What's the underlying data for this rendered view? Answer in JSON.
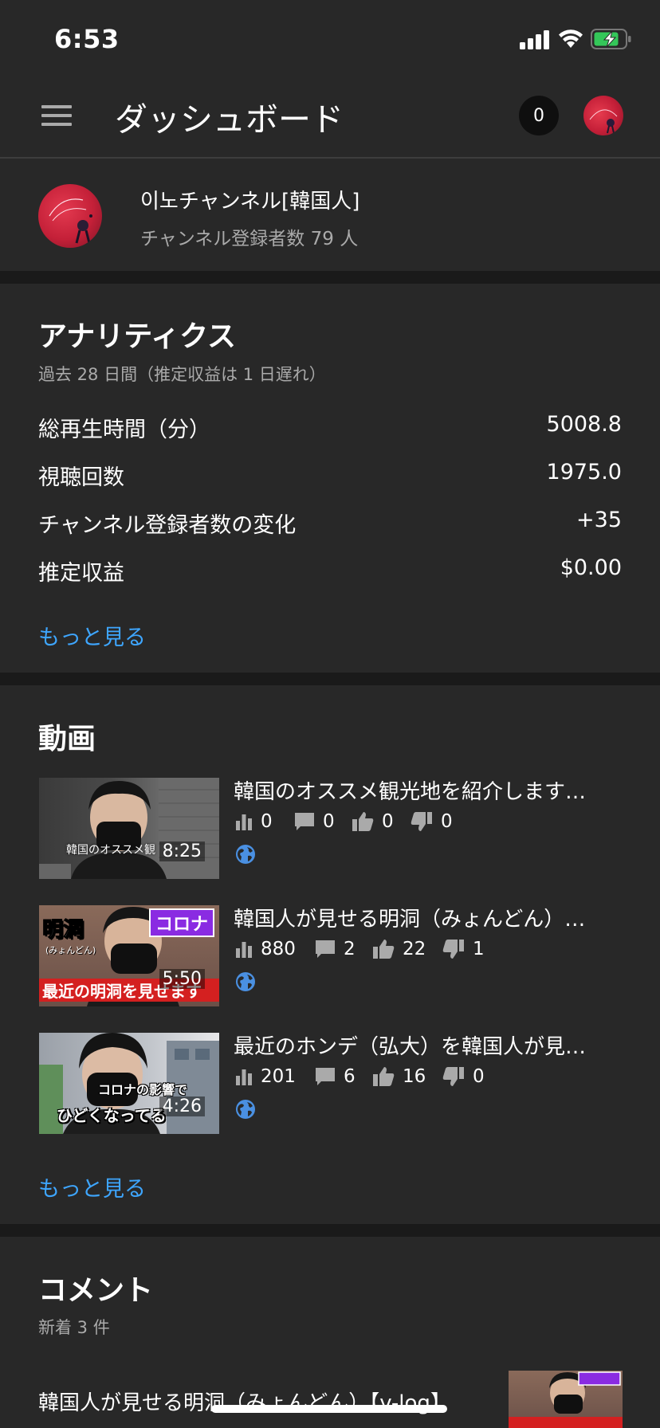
{
  "status_bar": {
    "time": "6:53"
  },
  "app_bar": {
    "title": "ダッシュボード",
    "notification_count": "0"
  },
  "channel": {
    "name": "이노チャンネル[韓国人]",
    "subscribers": "チャンネル登録者数 79 人"
  },
  "analytics": {
    "title": "アナリティクス",
    "subtitle": "過去 28 日間（推定収益は 1 日遅れ）",
    "metrics": [
      {
        "label": "総再生時間（分）",
        "value": "5008.8"
      },
      {
        "label": "視聴回数",
        "value": "1975.0"
      },
      {
        "label": "チャンネル登録者数の変化",
        "value": "+35"
      },
      {
        "label": "推定収益",
        "value": "$0.00"
      }
    ],
    "more": "もっと見る"
  },
  "videos": {
    "title": "動画",
    "items": [
      {
        "title": "韓国のオススメ観光地を紹介します…",
        "duration": "8:25",
        "views": "0",
        "comments": "0",
        "likes": "0",
        "dislikes": "0",
        "thumb_caption": "韓国のオススメ観"
      },
      {
        "title": "韓国人が見せる明洞（みょんどん）…",
        "duration": "5:50",
        "views": "880",
        "comments": "2",
        "likes": "22",
        "dislikes": "1",
        "thumb_caption_top": "明洞",
        "thumb_caption_small": "(みょんどん)",
        "thumb_caption_badge": "コロナ",
        "thumb_caption_bottom": "最近の明洞を見せます"
      },
      {
        "title": "最近のホンデ（弘大）を韓国人が見…",
        "duration": "4:26",
        "views": "201",
        "comments": "6",
        "likes": "16",
        "dislikes": "0",
        "thumb_caption_top": "コロナの影響で",
        "thumb_caption_bottom": "ひどくなってる"
      }
    ],
    "more": "もっと見る"
  },
  "comments": {
    "title": "コメント",
    "subtitle": "新着 3 件",
    "first_video_title": "韓国人が見せる明洞（みょんどん）【v-log】"
  },
  "colors": {
    "background": "#282828",
    "divider": "#1a1a1a",
    "link": "#3ea6ff",
    "secondary_text": "#aaaaaa"
  }
}
